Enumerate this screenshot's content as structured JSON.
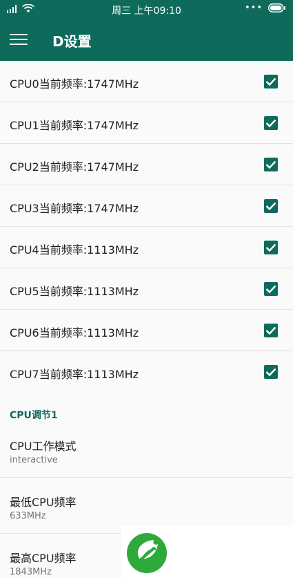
{
  "status": {
    "center_text": "周三 上午09:10",
    "dots": "•••"
  },
  "app": {
    "title": "D设置",
    "menu_icon": "hamburger-menu-icon"
  },
  "cpu_rows": [
    {
      "label": "CPU0当前频率:1747MHz",
      "checked": true
    },
    {
      "label": "CPU1当前频率:1747MHz",
      "checked": true
    },
    {
      "label": "CPU2当前频率:1747MHz",
      "checked": true
    },
    {
      "label": "CPU3当前频率:1747MHz",
      "checked": true
    },
    {
      "label": "CPU4当前频率:1113MHz",
      "checked": true
    },
    {
      "label": "CPU5当前频率:1113MHz",
      "checked": true
    },
    {
      "label": "CPU6当前频率:1113MHz",
      "checked": true
    },
    {
      "label": "CPU7当前频率:1113MHz",
      "checked": true
    }
  ],
  "section": {
    "header": "CPU调节1"
  },
  "prefs": [
    {
      "title": "CPU工作模式",
      "summary": "interactive"
    },
    {
      "title": "最低CPU频率",
      "summary": "633MHz"
    },
    {
      "title": "最高CPU频率",
      "summary": "1843MHz"
    }
  ],
  "colors": {
    "primary": "#0e6b5c",
    "logo_green": "#2eaa3c"
  }
}
